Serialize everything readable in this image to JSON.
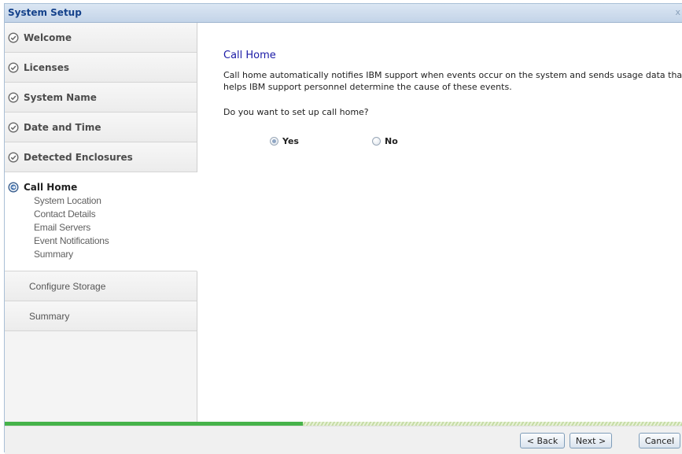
{
  "window": {
    "title": "System Setup",
    "close_glyph": "x"
  },
  "sidebar": {
    "completed_steps": [
      {
        "label": "Welcome",
        "icon": "check-circle-icon"
      },
      {
        "label": "Licenses",
        "icon": "check-circle-icon"
      },
      {
        "label": "System Name",
        "icon": "check-circle-icon"
      },
      {
        "label": "Date and Time",
        "icon": "check-circle-icon"
      },
      {
        "label": "Detected Enclosures",
        "icon": "check-circle-icon"
      }
    ],
    "active_step": {
      "label": "Call Home",
      "icon": "arrow-right-circle-icon",
      "substeps": [
        "System Location",
        "Contact Details",
        "Email Servers",
        "Event Notifications",
        "Summary"
      ]
    },
    "pending_steps": [
      {
        "label": "Configure Storage"
      },
      {
        "label": "Summary"
      }
    ]
  },
  "main": {
    "heading": "Call Home",
    "description": "Call home automatically notifies IBM support when events occur on the system and sends usage data that helps IBM support personnel determine the cause of these events.",
    "question": "Do you want to set up call home?",
    "options": [
      {
        "label": "Yes",
        "selected": true
      },
      {
        "label": "No",
        "selected": false
      }
    ]
  },
  "progress": {
    "fraction": 0.44
  },
  "footer": {
    "back_label": "< Back",
    "next_label": "Next >",
    "cancel_label": "Cancel"
  },
  "colors": {
    "heading": "#1a1aa6",
    "title": "#15428b",
    "progress": "#46b34a",
    "check": "#6a6a6a"
  }
}
